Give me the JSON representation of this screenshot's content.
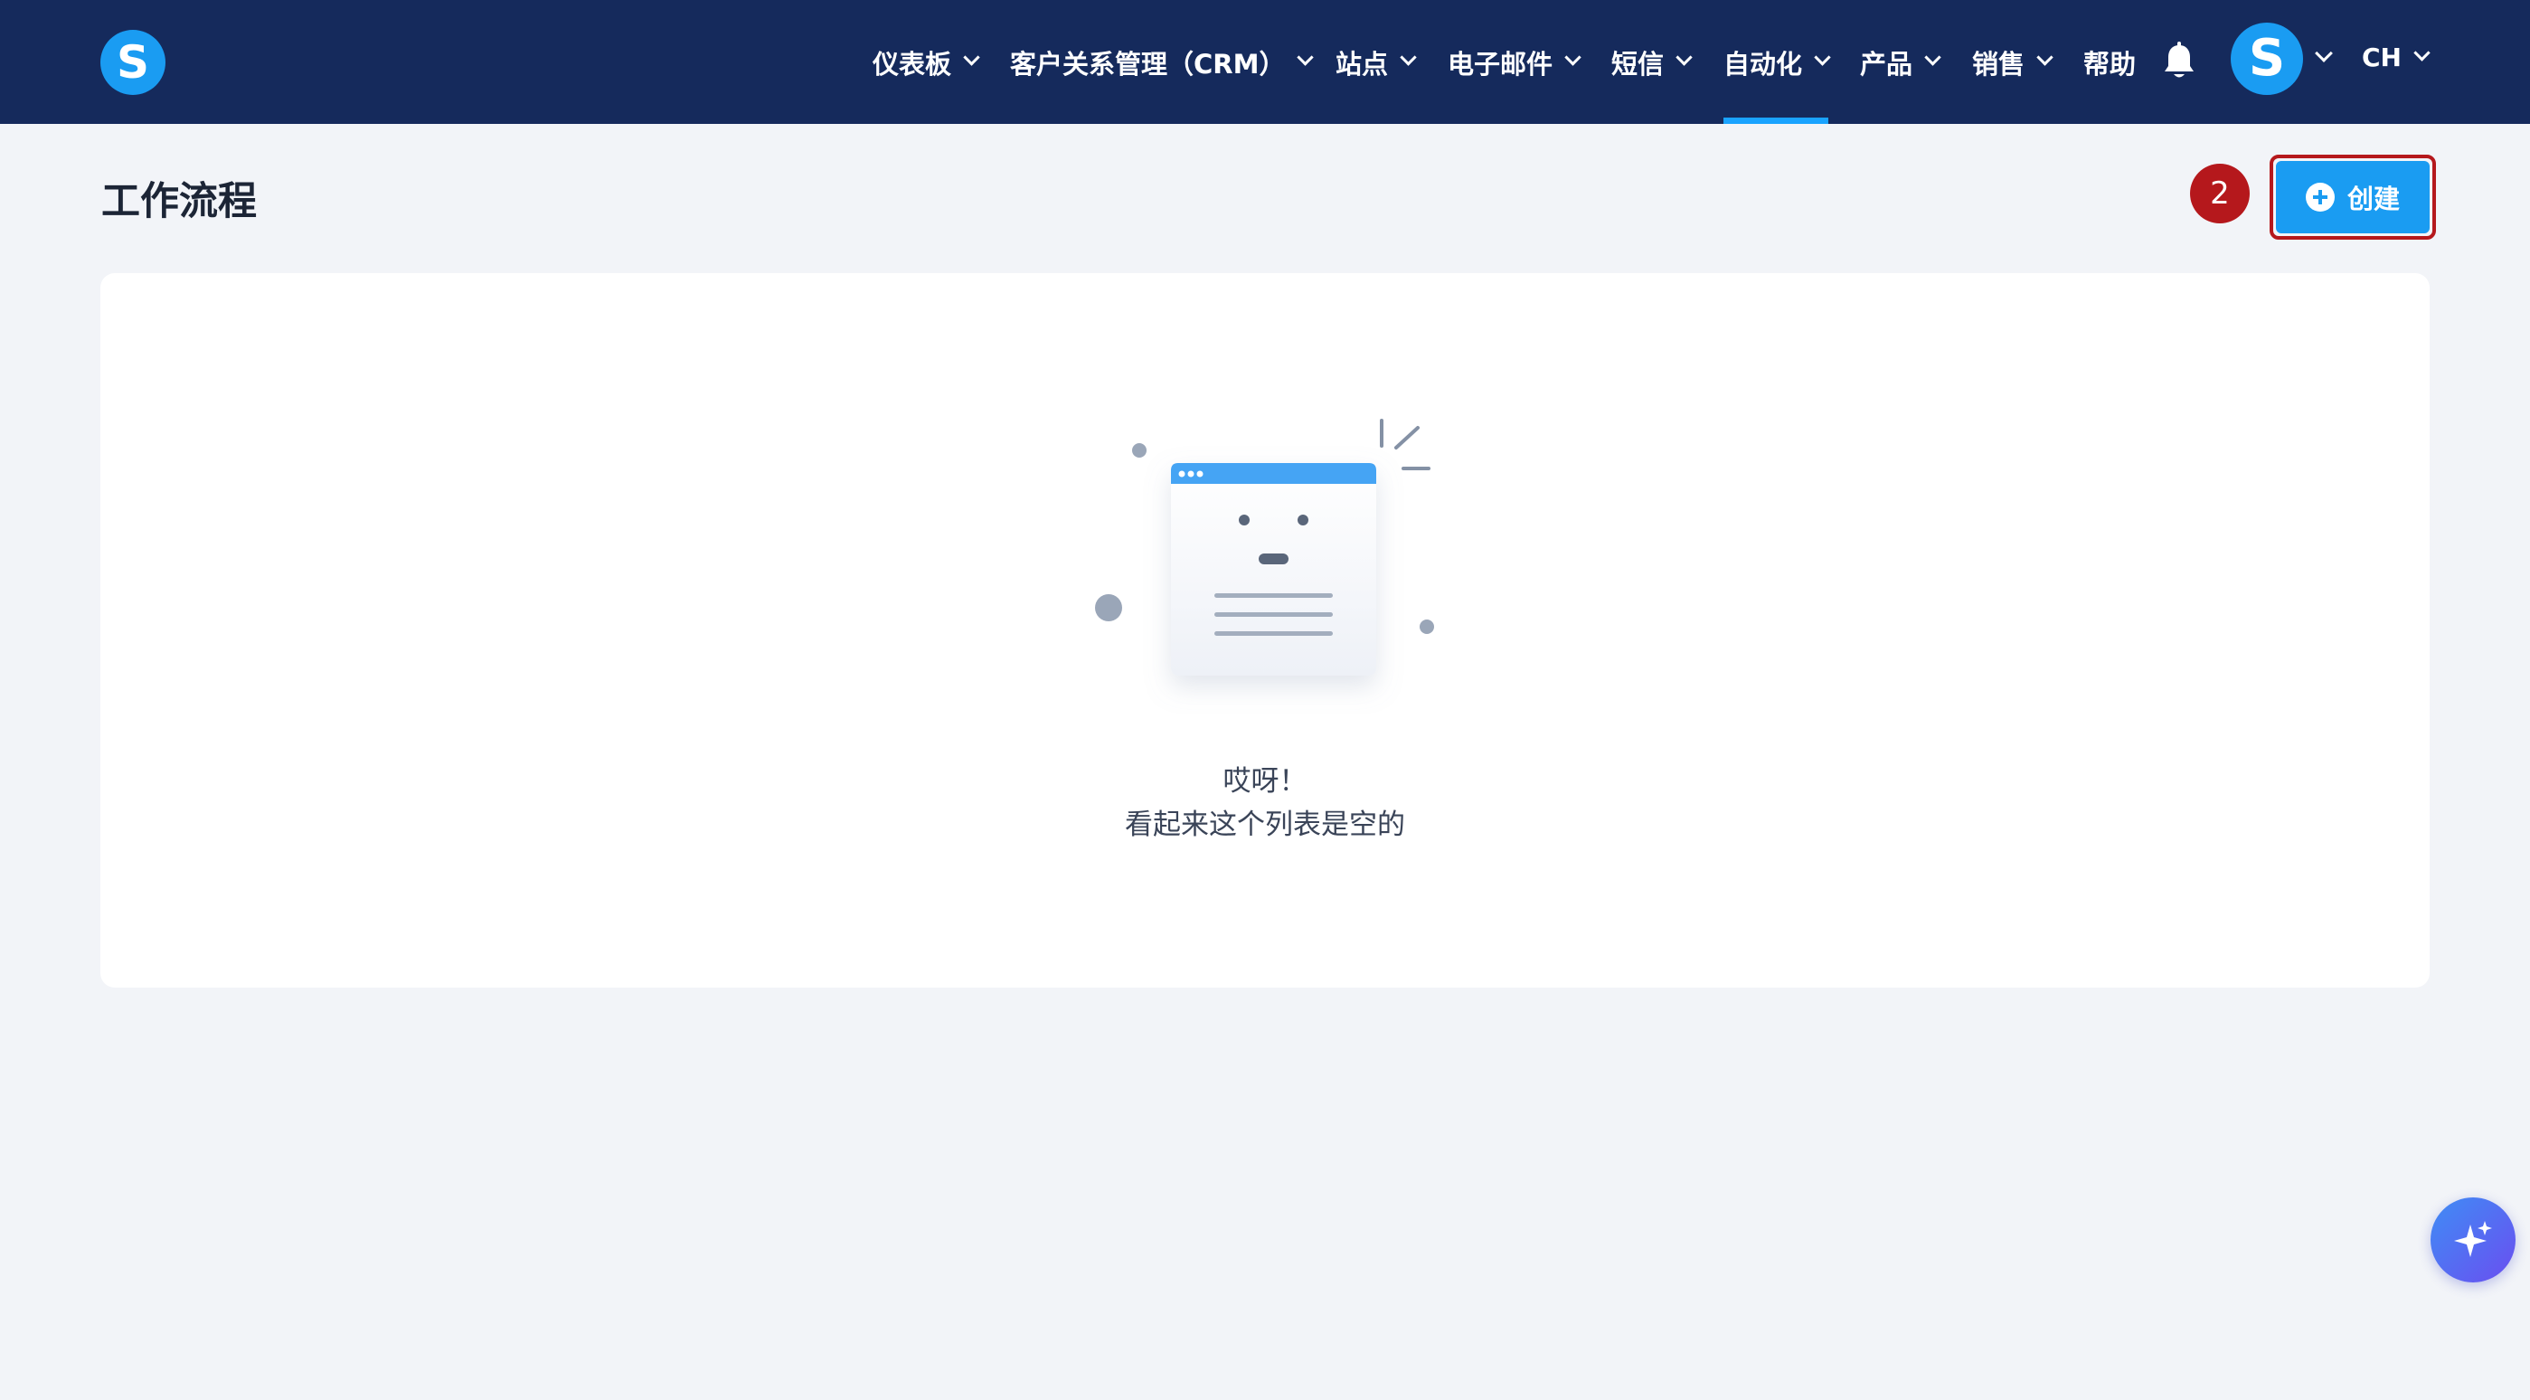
{
  "nav": {
    "logo_letter": "S",
    "items": [
      {
        "label": "仪表板",
        "has_dropdown": true
      },
      {
        "label": "客户关系管理（CRM）",
        "has_dropdown": true
      },
      {
        "label": "站点",
        "has_dropdown": true
      },
      {
        "label": "电子邮件",
        "has_dropdown": true
      },
      {
        "label": "短信",
        "has_dropdown": true
      },
      {
        "label": "自动化",
        "has_dropdown": true,
        "active": true
      },
      {
        "label": "产品",
        "has_dropdown": true
      },
      {
        "label": "销售",
        "has_dropdown": true
      },
      {
        "label": "帮助",
        "has_dropdown": false
      }
    ],
    "avatar_letter": "S",
    "language": "CH"
  },
  "page": {
    "title": "工作流程",
    "step_badge": "2",
    "create_label": "创建"
  },
  "empty_state": {
    "title": "哎呀！",
    "subtitle": "看起来这个列表是空的"
  },
  "colors": {
    "nav_bg": "#152a5c",
    "accent": "#1a9cf2",
    "highlight": "#b5181c",
    "page_bg": "#f2f4f8"
  },
  "icons": [
    "bell-icon",
    "chevron-down-icon",
    "plus-circle-icon",
    "sparkle-icon"
  ]
}
